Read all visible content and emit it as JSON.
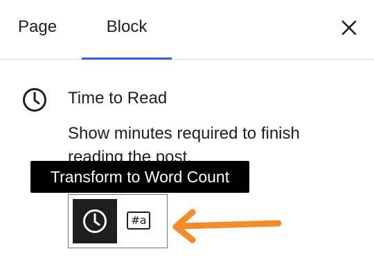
{
  "tabs": [
    {
      "label": "Page",
      "active": false
    },
    {
      "label": "Block",
      "active": true
    }
  ],
  "header": {
    "close_icon": "close-icon"
  },
  "block": {
    "icon": "clock-icon",
    "title": "Time to Read",
    "description": "Show minutes required to finish reading the post."
  },
  "tooltip": {
    "text": "Transform to Word Count"
  },
  "transforms": {
    "options": [
      {
        "name": "time-to-read",
        "icon": "clock-icon",
        "selected": true
      },
      {
        "name": "word-count",
        "icon": "word-count-icon",
        "glyph": "#a",
        "selected": false
      }
    ]
  },
  "annotation": {
    "arrow_icon": "arrow-left-icon",
    "color": "#f28c28"
  },
  "colors": {
    "accent": "#3858e9",
    "tooltip_bg": "#000000",
    "selected_bg": "#1e1e1e"
  }
}
